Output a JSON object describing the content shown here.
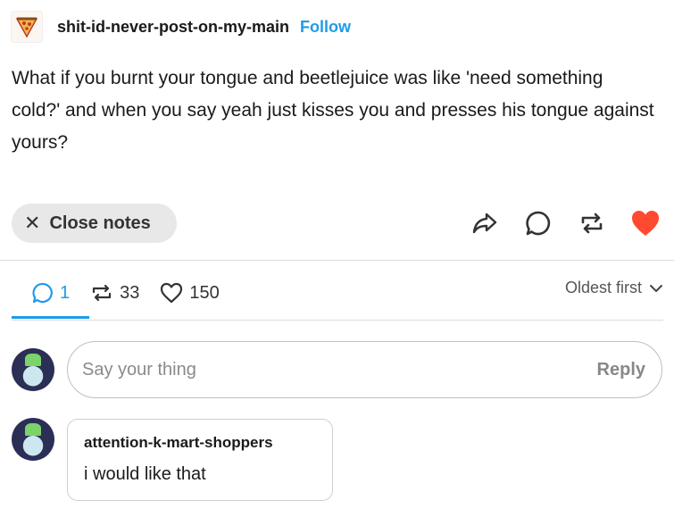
{
  "post": {
    "blog_name": "shit-id-never-post-on-my-main",
    "follow_label": "Follow",
    "body": "What if you burnt your tongue and beetlejuice was like 'need something cold?' and when you say yeah just kisses you and presses his tongue against yours?"
  },
  "actions": {
    "close_notes_label": "Close notes",
    "icons": [
      "share-icon",
      "comment-icon",
      "reblog-icon",
      "like-heart-icon"
    ],
    "like_color": "#ff4930"
  },
  "notes": {
    "tabs": [
      {
        "icon": "comment-icon",
        "count": "1",
        "active": true
      },
      {
        "icon": "reblog-icon",
        "count": "33",
        "active": false
      },
      {
        "icon": "heart-icon",
        "count": "150",
        "active": false
      }
    ],
    "sort_label": "Oldest first",
    "accent": "#1f9be8"
  },
  "reply": {
    "placeholder": "Say your thing",
    "button_label": "Reply"
  },
  "comments": [
    {
      "author": "attention-k-mart-shoppers",
      "text": "i would like that"
    }
  ]
}
